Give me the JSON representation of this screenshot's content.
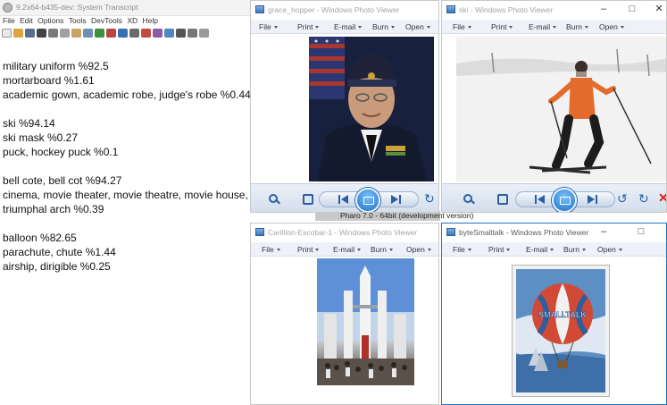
{
  "transcript": {
    "title": "9.2x64-b435-dev: System Transcript",
    "menu": [
      "File",
      "Edit",
      "Options",
      "Tools",
      "DevTools",
      "XD",
      "Help"
    ],
    "groups": [
      [
        "military uniform %92.5",
        "mortarboard %1.61",
        "academic gown, academic robe, judge's robe %0.44"
      ],
      [
        "ski %94.14",
        "ski mask %0.27",
        "puck, hockey puck %0.1"
      ],
      [
        "bell cote, bell cot %94.27",
        "cinema, movie theater, movie theatre, movie house, pic",
        "triumphal arch %0.39"
      ],
      [
        "balloon %82.65",
        "parachute, chute %1.44",
        "airship, dirigible %0.25"
      ]
    ]
  },
  "status_strip": "Pharo 7.0 - 64bit (development version)",
  "viewers": {
    "hopper": {
      "title": "grace_hopper - Windows Photo Viewer",
      "menu": [
        "File",
        "Print",
        "E-mail",
        "Burn",
        "Open"
      ]
    },
    "ski": {
      "title": "ski - Windows Photo Viewer",
      "menu": [
        "File",
        "Print",
        "E-mail",
        "Burn",
        "Open"
      ],
      "controls": [
        "–",
        "□",
        "✕"
      ]
    },
    "carillon": {
      "title": "Carillion-Escobar-1 - Windows Photo Viewer",
      "menu": [
        "File",
        "Print",
        "E-mail",
        "Burn",
        "Open"
      ]
    },
    "byte": {
      "title": "byteSmalltalk - Windows Photo Viewer",
      "menu": [
        "File",
        "Print",
        "E-mail",
        "Burn",
        "Open"
      ],
      "controls": [
        "–",
        "□"
      ]
    }
  },
  "picture_text": {
    "balloon_word": "SMALLTALK"
  },
  "icons": {
    "zoom": "magnifier-icon",
    "fit": "actual-size-icon",
    "prev": "previous-icon",
    "play": "slideshow-icon",
    "next": "next-icon",
    "rotate_left": "rotate-counterclockwise-icon",
    "rotate_right": "rotate-clockwise-icon",
    "delete": "delete-icon"
  },
  "colors": {
    "accent": "#1e73c8",
    "toolbar_gradient_top": "#eaf0f8",
    "toolbar_gradient_bottom": "#d3ddeb",
    "menu_bar": "#eef2f8",
    "delete_red": "#d2261a"
  }
}
